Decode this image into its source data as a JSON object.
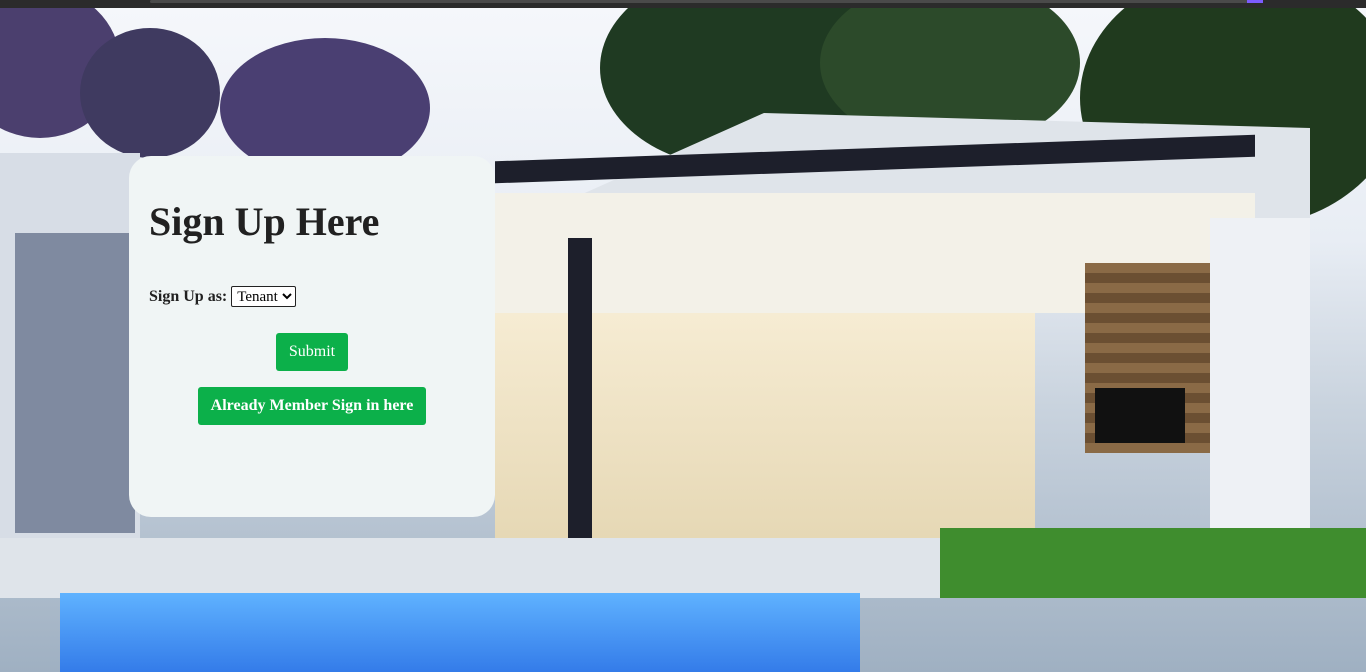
{
  "form": {
    "heading": "Sign Up Here",
    "role_label": "Sign Up as:",
    "role_selected": "Tenant",
    "submit_label": "Submit",
    "signin_label": "Already Member Sign in here"
  },
  "colors": {
    "button_green": "#0cb04a",
    "card_bg": "#f0f5f5"
  }
}
